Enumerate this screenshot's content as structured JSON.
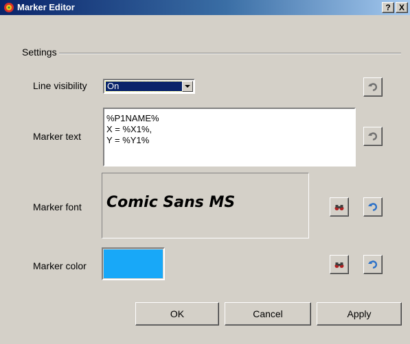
{
  "window": {
    "title": "Marker Editor",
    "help_button": "?",
    "close_button": "X"
  },
  "settings": {
    "group_label": "Settings",
    "line_visibility": {
      "label": "Line visibility",
      "value": "On"
    },
    "marker_text": {
      "label": "Marker text",
      "value": "%P1NAME%\nX = %X1%,\nY = %Y1%"
    },
    "marker_font": {
      "label": "Marker font",
      "sample": "Comic Sans MS"
    },
    "marker_color": {
      "label": "Marker color",
      "color": "#18a8f8"
    }
  },
  "icons": {
    "reset": "undo-arrow-icon",
    "browse": "binoculars-icon"
  },
  "buttons": {
    "ok": "OK",
    "cancel": "Cancel",
    "apply": "Apply"
  }
}
